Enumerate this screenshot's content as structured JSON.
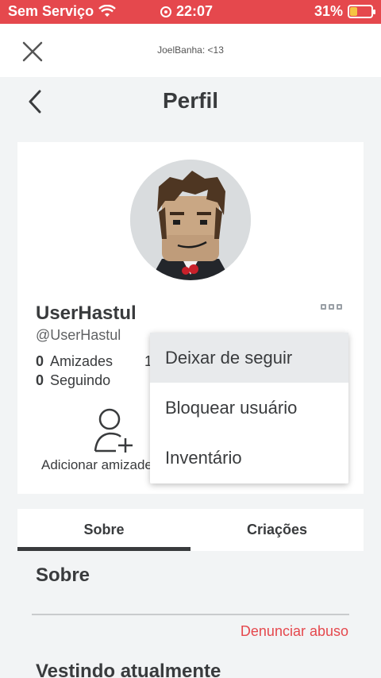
{
  "status_bar": {
    "carrier": "Sem Serviço",
    "time": "22:07",
    "battery_percent": "31%",
    "battery_level": 0.31,
    "color": "#e5484d"
  },
  "webview": {
    "title": "JoelBanha: <13"
  },
  "header": {
    "title": "Perfil"
  },
  "profile": {
    "display_name": "UserHastul",
    "username": "@UserHastul",
    "friends_count": "0",
    "friends_label": "Amizades",
    "following_count": "0",
    "following_label": "Seguindo",
    "partial_stat": "1",
    "add_friend_label": "Adicionar amizade"
  },
  "menu": {
    "items": [
      {
        "label": "Deixar de seguir"
      },
      {
        "label": "Bloquear usuário"
      },
      {
        "label": "Inventário"
      }
    ]
  },
  "tabs": [
    {
      "label": "Sobre"
    },
    {
      "label": "Criações"
    }
  ],
  "about": {
    "title": "Sobre",
    "report_label": "Denunciar abuso",
    "wearing_title": "Vestindo atualmente"
  },
  "icons": [
    "wifi-icon",
    "recording-icon",
    "battery-icon",
    "close-icon",
    "back-icon",
    "more-options-icon",
    "add-friend-icon"
  ]
}
